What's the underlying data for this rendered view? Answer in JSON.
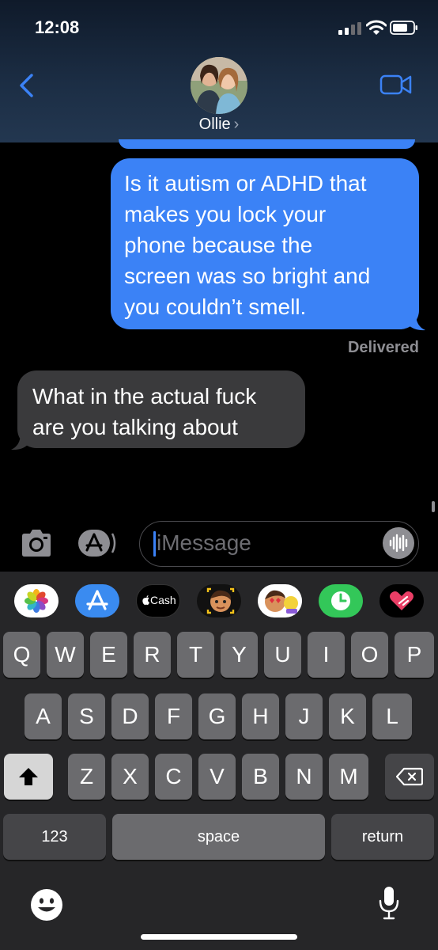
{
  "status_bar": {
    "time": "12:08"
  },
  "header": {
    "contact_name": "Ollie",
    "chevron": "›"
  },
  "messages": [
    {
      "direction": "outgoing",
      "lines": [
        "Is it autism or ADHD that",
        "makes you lock your",
        "phone because the",
        "screen was so bright and",
        "you couldn’t smell."
      ]
    },
    {
      "direction": "incoming",
      "lines": [
        "What in the actual fuck",
        "are you talking about"
      ]
    }
  ],
  "delivered_label": "Delivered",
  "input": {
    "placeholder": "iMessage"
  },
  "app_drawer": {
    "cash_label": "Cash",
    "apps": [
      "photos-icon",
      "appstore-icon",
      "apple-cash-icon",
      "memoji-icon",
      "memoji-stickers-icon",
      "clock-app-icon",
      "heart-app-icon"
    ]
  },
  "keyboard": {
    "row1": [
      "Q",
      "W",
      "E",
      "R",
      "T",
      "Y",
      "U",
      "I",
      "O",
      "P"
    ],
    "row2": [
      "A",
      "S",
      "D",
      "F",
      "G",
      "H",
      "J",
      "K",
      "L"
    ],
    "row3": [
      "Z",
      "X",
      "C",
      "V",
      "B",
      "N",
      "M"
    ],
    "numbers_key": "123",
    "space_key": "space",
    "return_key": "return"
  },
  "colors": {
    "outgoing_bubble": "#3b82f6",
    "incoming_bubble": "#3a3a3c",
    "accent": "#3b82f6"
  }
}
